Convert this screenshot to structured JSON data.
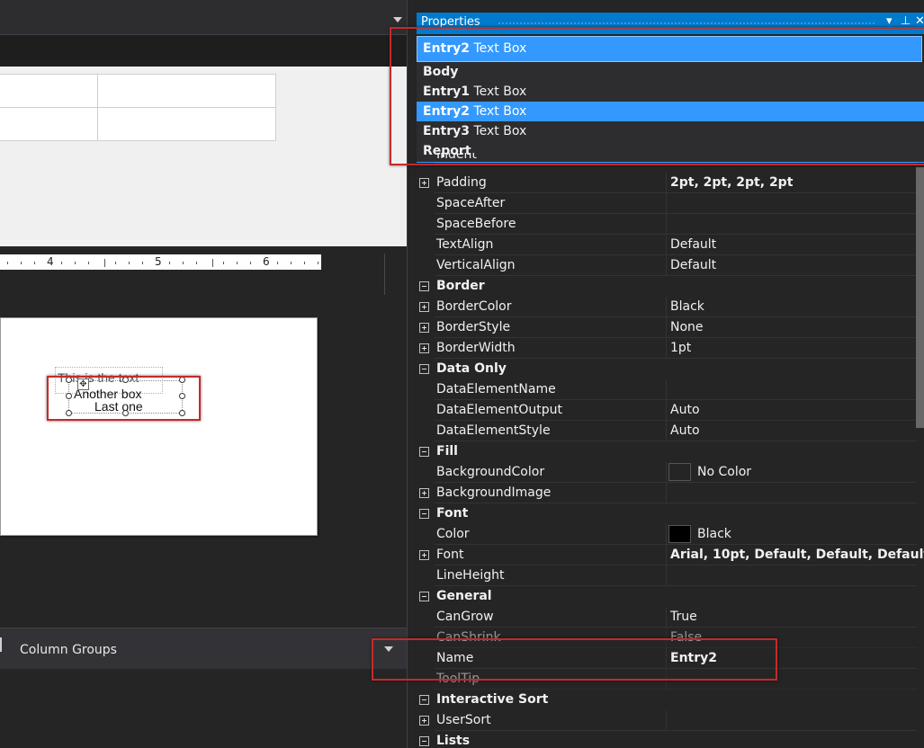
{
  "properties": {
    "title": "Properties",
    "pin_icon": "pin-icon",
    "close_icon": "close-icon",
    "dropdown_icon": "chevron-down-icon",
    "selector": {
      "name": "Entry2",
      "type": "Text Box"
    },
    "dropdown_items": [
      {
        "name": "Body",
        "type": ""
      },
      {
        "name": "Entry1",
        "type": "Text Box"
      },
      {
        "name": "Entry2",
        "type": "Text Box",
        "selected": true
      },
      {
        "name": "Entry3",
        "type": "Text Box"
      },
      {
        "name": "Report",
        "type": ""
      }
    ],
    "partially_hidden_row": "Indent",
    "rows": [
      {
        "kind": "item",
        "toggle": "plus",
        "name": "Padding",
        "value": "2pt, 2pt, 2pt, 2pt",
        "bold": true
      },
      {
        "kind": "item",
        "name": "SpaceAfter",
        "value": ""
      },
      {
        "kind": "item",
        "name": "SpaceBefore",
        "value": ""
      },
      {
        "kind": "item",
        "name": "TextAlign",
        "value": "Default"
      },
      {
        "kind": "item",
        "name": "VerticalAlign",
        "value": "Default"
      },
      {
        "kind": "cat",
        "name": "Border"
      },
      {
        "kind": "item",
        "toggle": "plus",
        "name": "BorderColor",
        "value": "Black"
      },
      {
        "kind": "item",
        "toggle": "plus",
        "name": "BorderStyle",
        "value": "None"
      },
      {
        "kind": "item",
        "toggle": "plus",
        "name": "BorderWidth",
        "value": "1pt"
      },
      {
        "kind": "cat",
        "name": "Data Only"
      },
      {
        "kind": "item",
        "name": "DataElementName",
        "value": ""
      },
      {
        "kind": "item",
        "name": "DataElementOutput",
        "value": "Auto"
      },
      {
        "kind": "item",
        "name": "DataElementStyle",
        "value": "Auto"
      },
      {
        "kind": "cat",
        "name": "Fill"
      },
      {
        "kind": "item",
        "name": "BackgroundColor",
        "value": "No Color",
        "swatch": "#252526"
      },
      {
        "kind": "item",
        "toggle": "plus",
        "name": "BackgroundImage",
        "value": ""
      },
      {
        "kind": "cat",
        "name": "Font"
      },
      {
        "kind": "item",
        "name": "Color",
        "value": "Black",
        "swatch": "#000000"
      },
      {
        "kind": "item",
        "toggle": "plus",
        "name": "Font",
        "value": "Arial, 10pt, Default, Default, Default",
        "bold": true
      },
      {
        "kind": "item",
        "name": "LineHeight",
        "value": ""
      },
      {
        "kind": "cat",
        "name": "General"
      },
      {
        "kind": "item",
        "name": "CanGrow",
        "value": "True"
      },
      {
        "kind": "item",
        "name": "CanShrink",
        "value": "False",
        "faded": true
      },
      {
        "kind": "item",
        "name": "Name",
        "value": "Entry2",
        "bold": true
      },
      {
        "kind": "item",
        "name": "ToolTip",
        "value": "",
        "faded": true
      },
      {
        "kind": "cat",
        "name": "Interactive Sort"
      },
      {
        "kind": "item",
        "toggle": "plus",
        "name": "UserSort",
        "value": ""
      },
      {
        "kind": "cat",
        "name": "Lists"
      }
    ]
  },
  "designer": {
    "ruler_labels": [
      "4",
      "5",
      "6"
    ],
    "textboxes": {
      "entry1_text": "This is the text",
      "entry2_text": "Another box",
      "entry3_text": "Last one"
    },
    "move_icon": "move-icon",
    "column_groups_label": "Column Groups"
  },
  "colors": {
    "accent": "#007acc",
    "selection": "#3399ff",
    "highlight_border": "#c42b2b",
    "panel_bg": "#252526"
  }
}
